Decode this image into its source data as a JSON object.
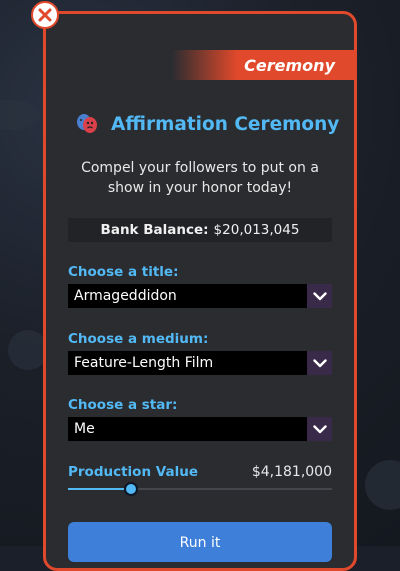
{
  "banner": {
    "label": "Ceremony"
  },
  "header": {
    "title": "Affirmation Ceremony",
    "icon": "theater-masks-icon"
  },
  "description": "Compel your followers to put on a show in your honor today!",
  "balance": {
    "label": "Bank Balance:",
    "value": "$20,013,045"
  },
  "fields": {
    "title": {
      "label": "Choose a title:",
      "value": "Armageddidon"
    },
    "medium": {
      "label": "Choose a medium:",
      "value": "Feature-Length Film"
    },
    "star": {
      "label": "Choose a star:",
      "value": "Me"
    }
  },
  "production": {
    "label": "Production Value",
    "value": "$4,181,000",
    "slider_fraction": 0.24
  },
  "run_button": {
    "label": "Run it"
  },
  "colors": {
    "accent": "#52b9f5",
    "border": "#e0492b",
    "card": "#2b2c30",
    "button": "#3d7fd9"
  }
}
